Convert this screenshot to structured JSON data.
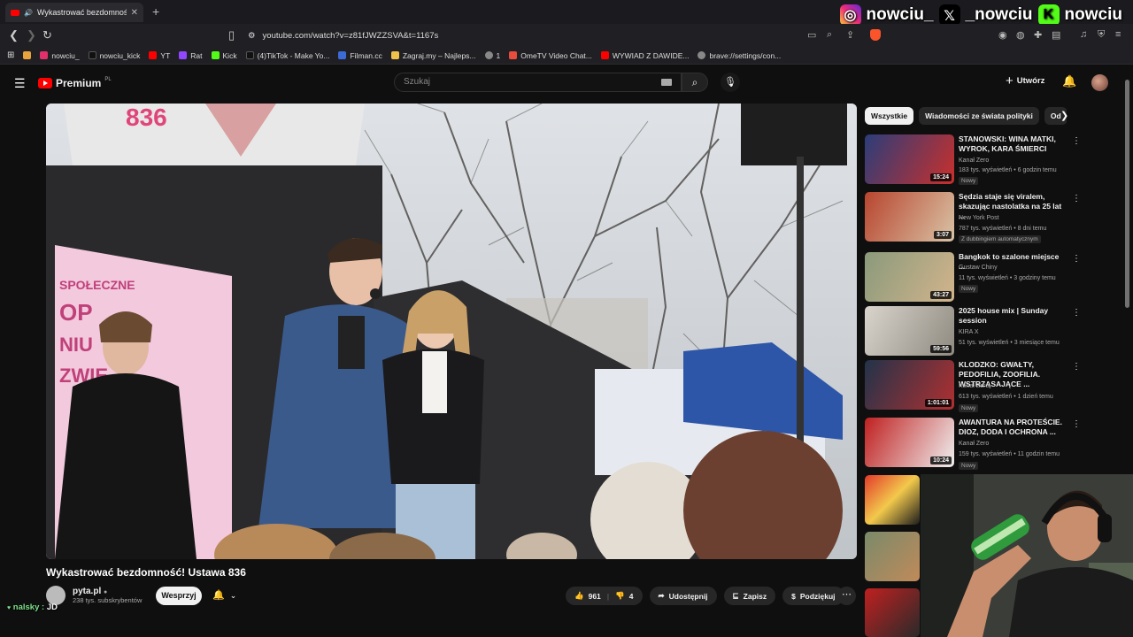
{
  "browser": {
    "tab_title": "Wykastrować bezdomność! U",
    "url": "youtube.com/watch?v=z81fJWZZSVA&t=1167s",
    "bookmarks": [
      {
        "label": "nowciu_",
        "color": "#e1306c"
      },
      {
        "label": "nowciu_kick",
        "color": "#111111"
      },
      {
        "label": "YT",
        "color": "#ff0000"
      },
      {
        "label": "Rat",
        "color": "#9146ff"
      },
      {
        "label": "Kick",
        "color": "#53fc18"
      },
      {
        "label": "(4)TikTok - Make Yo...",
        "color": "#111111"
      },
      {
        "label": "Filman.cc",
        "color": "#3a6bd6"
      },
      {
        "label": "Zagraj.my – Najleps...",
        "color": "#f0c24b"
      },
      {
        "label": "1",
        "color": "#888888"
      },
      {
        "label": "OmeTV Video Chat...",
        "color": "#e74c3c"
      },
      {
        "label": "WYWIAD Z DAWIDE...",
        "color": "#ff0000"
      },
      {
        "label": "brave://settings/con...",
        "color": "#888888"
      }
    ]
  },
  "overlay": {
    "instagram": "nowciu_",
    "x": "_nowciu",
    "kick": "nowciu",
    "chat_name": "nalsky :",
    "chat_msg": "JD"
  },
  "youtube": {
    "logo": "Premium",
    "logo_region": "PL",
    "search_placeholder": "Szukaj",
    "create_label": "Utwórz"
  },
  "video": {
    "title": "Wykastrować bezdomność! Ustawa 836",
    "channel": "pyta.pl",
    "subscribers": "238 tys. subskrybentów",
    "support_label": "Wesprzyj",
    "likes": "961",
    "dislikes": "4",
    "share_label": "Udostępnij",
    "save_label": "Zapisz",
    "thanks_label": "Podziękuj"
  },
  "sidebar": {
    "chips": [
      "Wszystkie",
      "Wiadomości ze świata polityki",
      "Od"
    ],
    "recommendations": [
      {
        "title": "STANOWSKI: WINA MATKI, WYROK, KARA ŚMIERCI",
        "channel": "Kanał Zero",
        "meta": "183 tys. wyświetleń • 6 godzin temu",
        "badge": "Nowy",
        "duration": "15:24",
        "colors": [
          "#2b3d7a",
          "#c9302c"
        ]
      },
      {
        "title": "Sędzia staje się viralem, skazując nastolatka na 25 lat ...",
        "channel": "New York Post",
        "meta": "787 tys. wyświetleń • 8 dni temu",
        "badge": "Z dubbingiem automatycznym",
        "duration": "3:07",
        "colors": [
          "#b8452f",
          "#d9c3a5"
        ]
      },
      {
        "title": "Bangkok to szalone miejsce ...",
        "channel": "Gustaw Chiny",
        "meta": "11 tys. wyświetleń • 3 godziny temu",
        "badge": "Nowy",
        "duration": "43:27",
        "colors": [
          "#8a9a7b",
          "#d2b48c"
        ]
      },
      {
        "title": "2025 house mix | Sunday session",
        "channel": "KIRA X",
        "meta": "51 tys. wyświetleń • 3 miesiące temu",
        "badge": "",
        "duration": "59:56",
        "colors": [
          "#d9d4cc",
          "#8f8a80"
        ]
      },
      {
        "title": "KLODZKO: GWAŁTY, PEDOFILIA, ZOOFILIA. WSTRZĄSAJĄCE ...",
        "channel": "Kanał Zero",
        "meta": "613 tys. wyświetleń • 1 dzień temu",
        "badge": "Nowy",
        "duration": "1:01:01",
        "colors": [
          "#22334a",
          "#b03030"
        ]
      },
      {
        "title": "AWANTURA NA PROTEŚCIE. DIOZ, DODA I OCHRONA ...",
        "channel": "Kanał Zero",
        "meta": "159 tys. wyświetleń • 11 godzin temu",
        "badge": "Nowy",
        "duration": "10:24",
        "colors": [
          "#c02020",
          "#f0f0f0"
        ]
      }
    ]
  }
}
